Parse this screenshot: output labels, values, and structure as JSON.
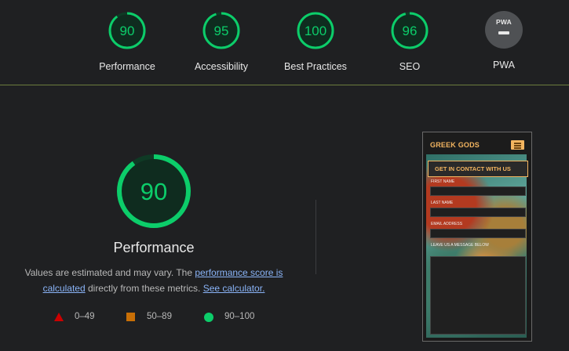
{
  "summary": [
    {
      "name": "Performance",
      "score": "90",
      "fraction": 0.9
    },
    {
      "name": "Accessibility",
      "score": "95",
      "fraction": 0.95
    },
    {
      "name": "Best Practices",
      "score": "100",
      "fraction": 1.0
    },
    {
      "name": "SEO",
      "score": "96",
      "fraction": 0.96
    }
  ],
  "pwa": {
    "name": "PWA",
    "badge": "PWA"
  },
  "main": {
    "score": "90",
    "fraction": 0.9,
    "title": "Performance",
    "desc_before": "Values are estimated and may vary. The ",
    "link1": "performance score is calculated",
    "desc_middle": " directly from these metrics. ",
    "link2": "See calculator."
  },
  "legend": [
    {
      "range": "0–49"
    },
    {
      "range": "50–89"
    },
    {
      "range": "90–100"
    }
  ],
  "colors": {
    "pass": "#0ccd6a",
    "average": "#c86f06",
    "fail": "#cc0000"
  },
  "screenshot": {
    "brand": "GREEK GODS",
    "contact": "GET IN CONTACT WITH US",
    "fields": [
      "FIRST NAME",
      "LAST NAME",
      "EMAIL ADDRESS",
      "LEAVE US A MESSAGE BELOW"
    ]
  }
}
